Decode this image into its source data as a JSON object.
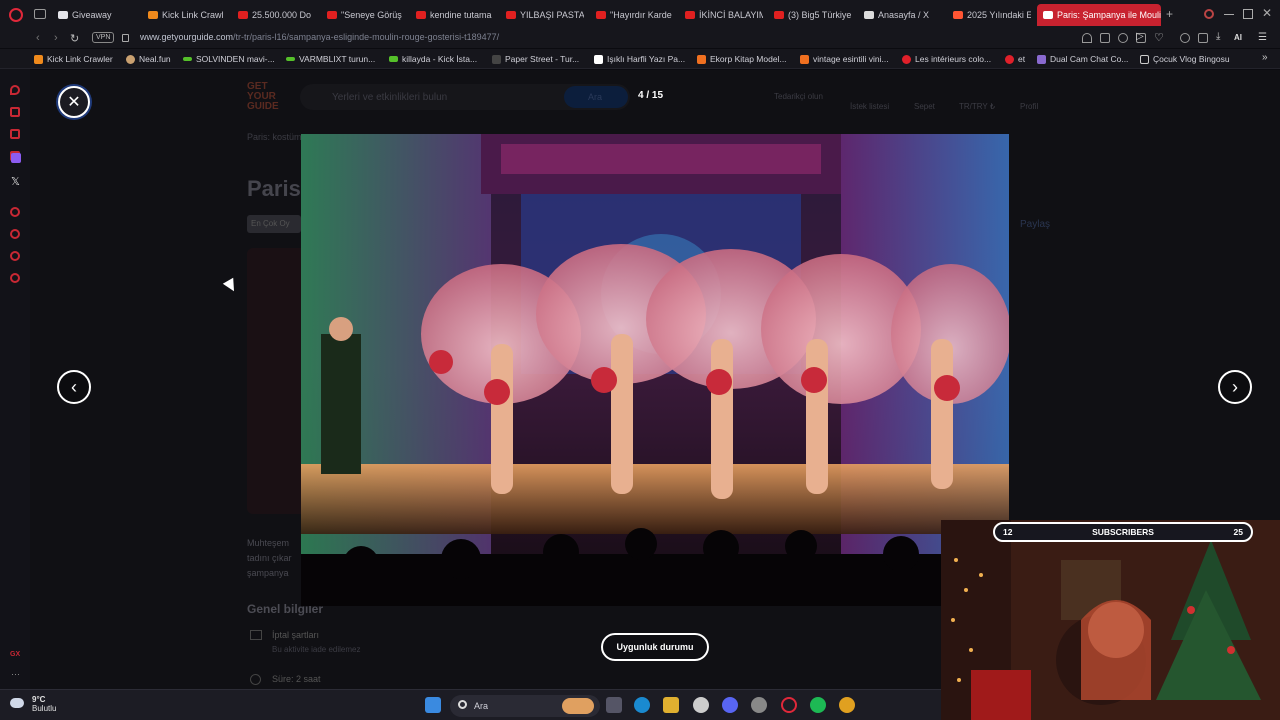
{
  "browser": {
    "tabs": [
      {
        "label": "Giveaway",
        "favicon": "discord-icon"
      },
      {
        "label": "Kick Link Crawl",
        "favicon": "kick-icon"
      },
      {
        "label": "25.500.000 Do",
        "favicon": "youtube-icon"
      },
      {
        "label": "\"Seneye Görüş",
        "favicon": "youtube-icon"
      },
      {
        "label": "kendine tutama",
        "favicon": "youtube-icon"
      },
      {
        "label": "YILBAŞI PASTA",
        "favicon": "youtube-icon"
      },
      {
        "label": "\"Hayırdır Karde",
        "favicon": "youtube-icon"
      },
      {
        "label": "İKİNCİ BALAYIM",
        "favicon": "youtube-icon"
      },
      {
        "label": "(3) Big5 Türkiye",
        "favicon": "youtube-icon"
      },
      {
        "label": "Anasayfa / X",
        "favicon": "x-icon"
      },
      {
        "label": "2025 Yılındaki E",
        "favicon": "getyourguide-icon"
      },
      {
        "label": "Paris: Şampanya ile Mouli",
        "favicon": "getyourguide-icon",
        "active": true
      }
    ],
    "new_tab_symbol": "+",
    "address": {
      "vpn_label": "VPN",
      "url_host": "www.getyourguide.com",
      "url_path": "/tr-tr/paris-l16/sampanya-esliginde-moulin-rouge-gosterisi-t189477/",
      "ai_label": "AI"
    },
    "bookmarks": [
      {
        "label": "Kick Link Crawler",
        "favicon": "kick-icon"
      },
      {
        "label": "Neal.fun",
        "favicon": "neal-icon"
      },
      {
        "label": "SOLVINDEN mavi-...",
        "favicon": "kick-icon"
      },
      {
        "label": "VARMBLIXT turun...",
        "favicon": "kick-icon"
      },
      {
        "label": "killayda - Kick İsta...",
        "favicon": "kick-icon"
      },
      {
        "label": "Paper Street - Tur...",
        "favicon": "folder-icon"
      },
      {
        "label": "Işıklı Harfli Yazı Pa...",
        "favicon": "page-icon"
      },
      {
        "label": "Ekorp Kitap Model...",
        "favicon": "shop-icon"
      },
      {
        "label": "vintage esintili vini...",
        "favicon": "shop-icon"
      },
      {
        "label": "Les intérieurs colo...",
        "favicon": "pinterest-icon"
      },
      {
        "label": "et",
        "favicon": "pinterest-icon"
      },
      {
        "label": "Dual Cam Chat Co...",
        "favicon": "page-icon"
      },
      {
        "label": "Çocuk Vlog Bingosu",
        "favicon": "doc-icon"
      }
    ]
  },
  "page": {
    "logo": "GET YOUR GUIDE",
    "search_placeholder": "Yerleri ve etkinlikleri bulun",
    "search_button": "Ara",
    "header_links": [
      "Tedarikçi olun",
      "İstek listesi",
      "Sepet",
      "TR/TRY ₺",
      "Profil"
    ],
    "breadcrumb": "Paris: kostüm",
    "title_fragment": "Paris",
    "badge": "En Çok Oy",
    "share": "Paylaş",
    "description_lines": [
      "Muhteşem",
      "tadını çıkar",
      "şampanya"
    ],
    "section_title": "Genel bilgiler",
    "info": [
      {
        "title": "İptal şartları",
        "sub": "Bu aktivite iade edilemez"
      },
      {
        "title": "Süre: 2 saat",
        "sub": ""
      }
    ]
  },
  "gallery": {
    "counter": "4 / 15",
    "close_symbol": "✕",
    "prev_symbol": "‹",
    "next_symbol": "›",
    "availability_button": "Uygunluk durumu"
  },
  "stream_overlay": {
    "left_count": "12",
    "label": "SUBSCRIBERS",
    "right_count": "25"
  },
  "taskbar": {
    "weather_temp": "9°C",
    "weather_desc": "Bulutlu",
    "search_label": "Ara"
  },
  "colors": {
    "opera_red": "#e0283a",
    "active_tab": "#c8222f",
    "gyg_red": "#ff5533",
    "gyg_blue": "#0e3c8a"
  }
}
